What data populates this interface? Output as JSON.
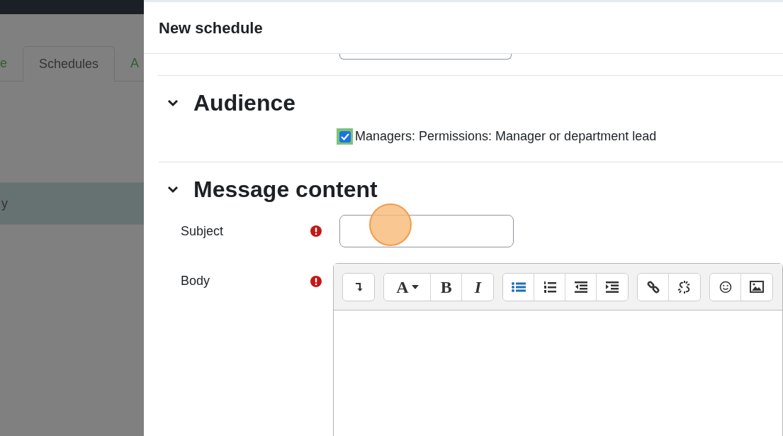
{
  "background_page": {
    "tabs": [
      {
        "label": "e",
        "selected": false
      },
      {
        "label": "Schedules",
        "selected": true
      },
      {
        "label": "A",
        "selected": false
      }
    ],
    "nav_items": [
      {
        "label": "y",
        "selected": true
      }
    ]
  },
  "dialog": {
    "title": "New schedule",
    "sections": [
      {
        "title": "Audience",
        "expanded": true,
        "options": [
          {
            "label": "Managers: Permissions: Manager or department lead",
            "checked": true
          }
        ]
      },
      {
        "title": "Message content",
        "expanded": true
      }
    ],
    "fields": [
      {
        "label": "Subject",
        "required": true
      },
      {
        "label": "Body",
        "required": true
      }
    ],
    "toolbar": [
      [
        {
          "kind": "more"
        }
      ],
      [
        {
          "kind": "font",
          "label": "A"
        },
        {
          "kind": "bold",
          "label": "B"
        },
        {
          "kind": "italic",
          "label": "I"
        }
      ],
      [
        {
          "kind": "bullets"
        },
        {
          "kind": "numbers"
        },
        {
          "kind": "outdent"
        },
        {
          "kind": "indent"
        }
      ],
      [
        {
          "kind": "link"
        },
        {
          "kind": "unlink"
        }
      ],
      [
        {
          "kind": "emoji"
        },
        {
          "kind": "image"
        }
      ]
    ]
  }
}
